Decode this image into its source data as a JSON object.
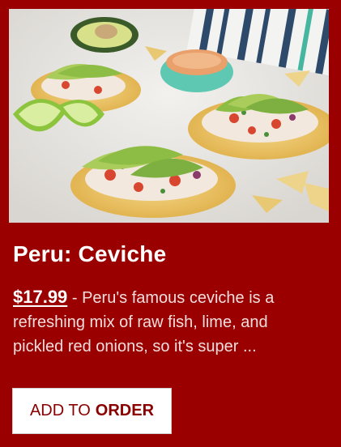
{
  "product": {
    "image_alt": "Ceviche tostadas topped with avocado slices, lime wedges and chips",
    "title": "Peru: Ceviche",
    "price": "$17.99",
    "description": " - Peru's famous ceviche is a refreshing mix of raw fish, lime, and pickled red onions, so it's super ..."
  },
  "button": {
    "label_prefix": "ADD TO",
    "label_emphasis": "ORDER"
  },
  "colors": {
    "card_background": "#9a0000",
    "button_text": "#8a0000"
  }
}
